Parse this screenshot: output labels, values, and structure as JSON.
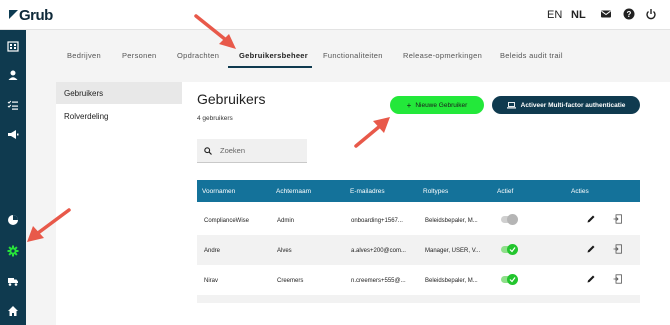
{
  "app": {
    "logo": "Grub"
  },
  "header": {
    "lang_en": "EN",
    "lang_nl": "NL"
  },
  "tabs": [
    {
      "label": "Bedrijven"
    },
    {
      "label": "Personen"
    },
    {
      "label": "Opdrachten"
    },
    {
      "label": "Gebruikersbeheer"
    },
    {
      "label": "Functionaliteiten"
    },
    {
      "label": "Release-opmerkingen"
    },
    {
      "label": "Beleids audit trail"
    }
  ],
  "left_panel": {
    "items": [
      {
        "label": "Gebruikers"
      },
      {
        "label": "Rolverdeling"
      }
    ]
  },
  "main": {
    "title": "Gebruikers",
    "count": "4 gebruikers",
    "new_user_label": "Nieuwe Gebruiker",
    "mfa_label": "Activeer Multi-factor authenticatie",
    "search_placeholder": "Zoeken"
  },
  "table": {
    "headers": [
      "Voornamen",
      "Achternaam",
      "E-mailadres",
      "Roltypes",
      "Actief",
      "Acties"
    ],
    "rows": [
      {
        "voornaam": "ComplianceWise",
        "achternaam": "Admin",
        "email": "onboarding+1567...",
        "rol": "Beleidsbepaler, M...",
        "actief": false
      },
      {
        "voornaam": "Andre",
        "achternaam": "Alves",
        "email": "a.alves+200@com...",
        "rol": "Manager, USER, V...",
        "actief": true
      },
      {
        "voornaam": "Nirav",
        "achternaam": "Creemers",
        "email": "n.creemers+555@...",
        "rol": "Beleidsbepaler, M...",
        "actief": true
      }
    ]
  },
  "colors": {
    "accent_green": "#23e83a",
    "sidebar": "#0f3a4f",
    "table_header": "#14729a",
    "annotation_arrow": "#e8594a"
  }
}
